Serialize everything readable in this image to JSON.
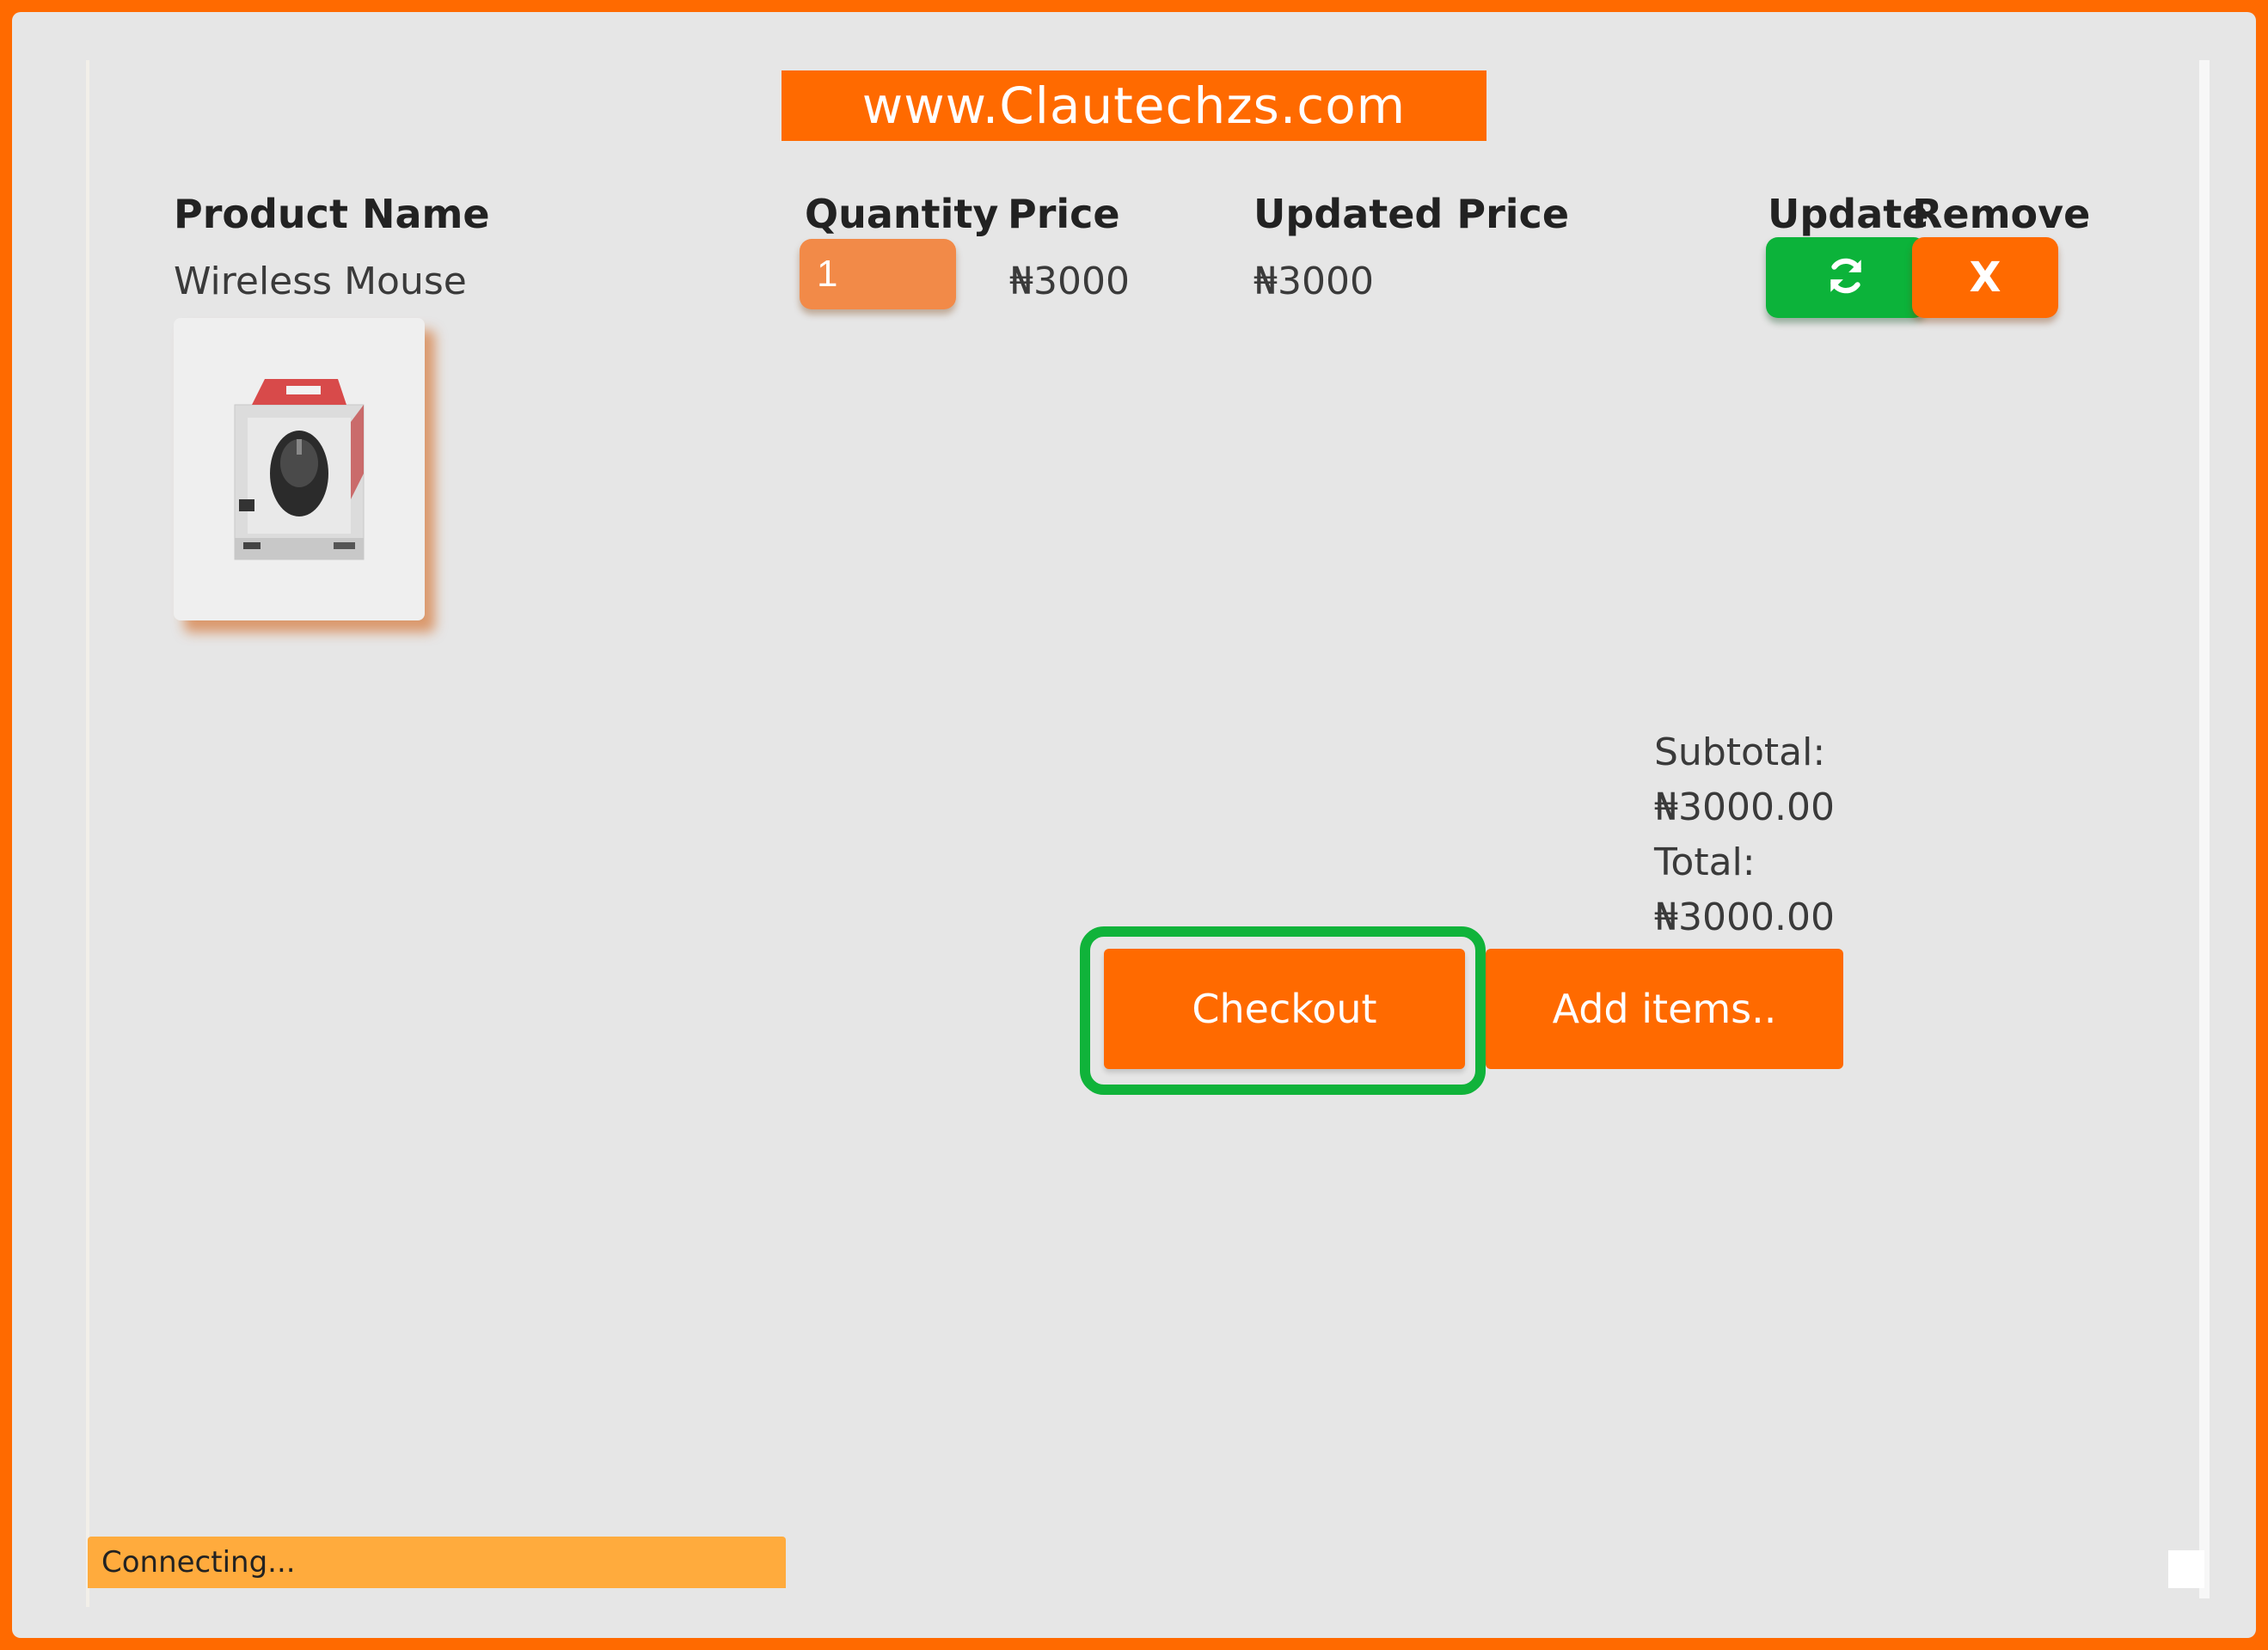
{
  "banner": {
    "text": "www.Clautechzs.com"
  },
  "cart": {
    "headers": {
      "product_name": "Product Name",
      "quantity": "Quantity",
      "price": "Price",
      "updated_price": "Updated Price",
      "update": "Update",
      "remove": "Remove"
    },
    "items": [
      {
        "name": "Wireless Mouse",
        "quantity": "1",
        "price": "₦3000",
        "updated_price": "₦3000",
        "update_icon": "refresh-icon",
        "remove_label": "X"
      }
    ]
  },
  "summary": {
    "subtotal_label": "Subtotal:",
    "subtotal_value": "₦3000.00",
    "total_label": "Total:",
    "total_value": "₦3000.00"
  },
  "actions": {
    "checkout_label": "Checkout",
    "add_items_label": "Add items.."
  },
  "status": {
    "text": "Connecting..."
  },
  "colors": {
    "brand_orange": "#ff6a00",
    "update_green": "#0cb33a",
    "highlight_green": "#10b33a",
    "background": "#e6e6e6",
    "status_bar": "#ffab3d"
  }
}
